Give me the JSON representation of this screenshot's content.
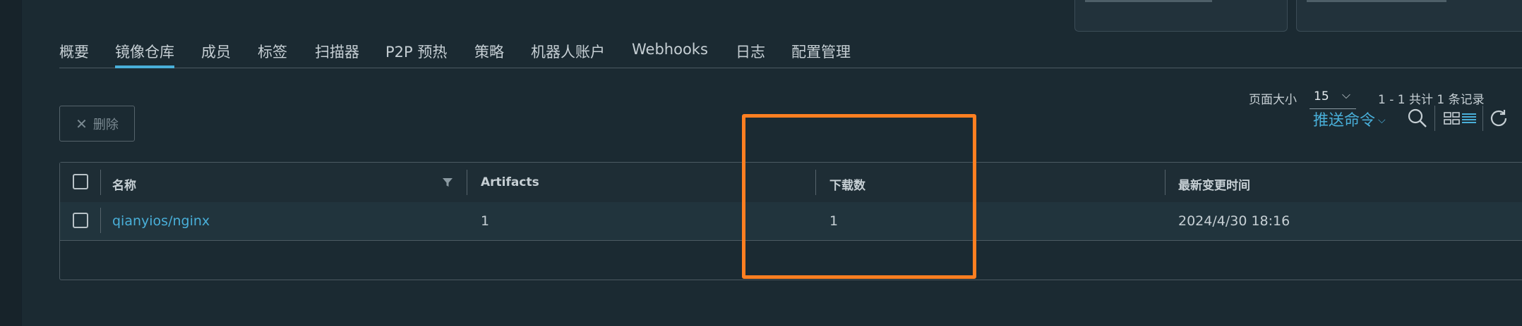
{
  "tabs": [
    {
      "label": "概要",
      "active": false
    },
    {
      "label": "镜像仓库",
      "active": true
    },
    {
      "label": "成员",
      "active": false
    },
    {
      "label": "标签",
      "active": false
    },
    {
      "label": "扫描器",
      "active": false
    },
    {
      "label": "P2P 预热",
      "active": false
    },
    {
      "label": "策略",
      "active": false
    },
    {
      "label": "机器人账户",
      "active": false
    },
    {
      "label": "Webhooks",
      "active": false
    },
    {
      "label": "日志",
      "active": false
    },
    {
      "label": "配置管理",
      "active": false
    }
  ],
  "toolbar": {
    "delete_label": "删除",
    "push_command_label": "推送命令",
    "icons": [
      "search-icon",
      "card-view-icon",
      "list-view-icon",
      "refresh-icon"
    ]
  },
  "table": {
    "columns": [
      "名称",
      "Artifacts",
      "下载数",
      "最新变更时间"
    ],
    "rows": [
      {
        "name": "qianyios/nginx",
        "artifacts": "1",
        "downloads": "1",
        "updated": "2024/4/30 18:16"
      }
    ]
  },
  "pagination": {
    "page_size_label": "页面大小",
    "page_size": "15",
    "summary": "1 - 1 共计 1 条记录"
  },
  "colors": {
    "background": "#1b2a32",
    "accent": "#49afd9",
    "highlight": "#ff7f21"
  }
}
